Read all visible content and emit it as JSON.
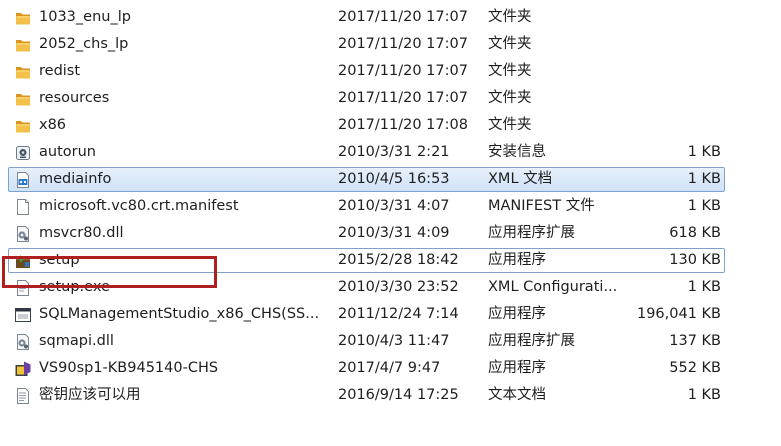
{
  "files": [
    {
      "name": "1033_enu_lp",
      "date": "2017/11/20 17:07",
      "type": "文件夹",
      "size": "",
      "icon": "folder-icon"
    },
    {
      "name": "2052_chs_lp",
      "date": "2017/11/20 17:07",
      "type": "文件夹",
      "size": "",
      "icon": "folder-icon"
    },
    {
      "name": "redist",
      "date": "2017/11/20 17:07",
      "type": "文件夹",
      "size": "",
      "icon": "folder-icon"
    },
    {
      "name": "resources",
      "date": "2017/11/20 17:07",
      "type": "文件夹",
      "size": "",
      "icon": "folder-icon"
    },
    {
      "name": "x86",
      "date": "2017/11/20 17:08",
      "type": "文件夹",
      "size": "",
      "icon": "folder-icon"
    },
    {
      "name": "autorun",
      "date": "2010/3/31 2:21",
      "type": "安装信息",
      "size": "1 KB",
      "icon": "setup-info-icon"
    },
    {
      "name": "mediainfo",
      "date": "2010/4/5 16:53",
      "type": "XML 文档",
      "size": "1 KB",
      "icon": "xml-document-icon",
      "selected": true
    },
    {
      "name": "microsoft.vc80.crt.manifest",
      "date": "2010/3/31 4:07",
      "type": "MANIFEST 文件",
      "size": "1 KB",
      "icon": "blank-file-icon"
    },
    {
      "name": "msvcr80.dll",
      "date": "2010/3/31 4:09",
      "type": "应用程序扩展",
      "size": "618 KB",
      "icon": "dll-file-icon"
    },
    {
      "name": "setup",
      "date": "2015/2/28 18:42",
      "type": "应用程序",
      "size": "130 KB",
      "icon": "installer-icon",
      "focused": true
    },
    {
      "name": "setup.exe",
      "date": "2010/3/30 23:52",
      "type": "XML Configurati...",
      "size": "1 KB",
      "icon": "config-file-icon"
    },
    {
      "name": "SQLManagementStudio_x86_CHS(SS...",
      "date": "2011/12/24 7:14",
      "type": "应用程序",
      "size": "196,041 KB",
      "icon": "application-icon"
    },
    {
      "name": "sqmapi.dll",
      "date": "2010/4/3 11:47",
      "type": "应用程序扩展",
      "size": "137 KB",
      "icon": "dll-file-icon"
    },
    {
      "name": "VS90sp1-KB945140-CHS",
      "date": "2017/4/7 9:47",
      "type": "应用程序",
      "size": "552 KB",
      "icon": "vs-installer-icon"
    },
    {
      "name": "密钥应该可以用",
      "date": "2016/9/14 17:25",
      "type": "文本文档",
      "size": "1 KB",
      "icon": "text-file-icon"
    }
  ],
  "annotation": {
    "highlighted_item": "setup",
    "highlight_color": "#b01e1e"
  },
  "colors": {
    "folder": "#e8a52a",
    "selection_border": "#7da2ce",
    "selection_fill": "#d6e6f8"
  }
}
